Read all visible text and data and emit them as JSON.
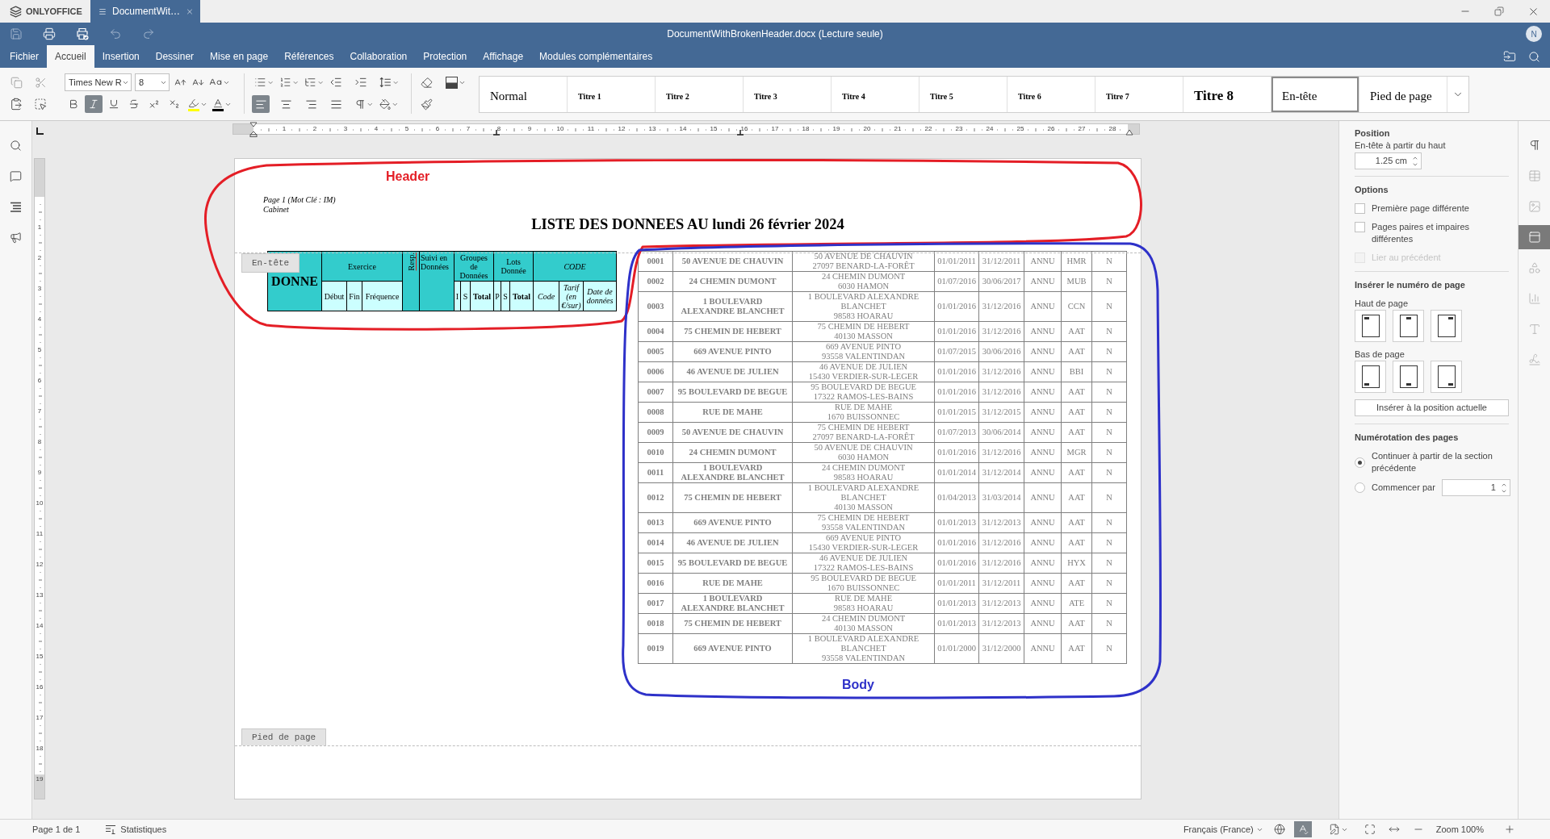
{
  "window": {
    "brand": "ONLYOFFICE",
    "tabs": [
      {
        "label": "DocumentWit…",
        "selected": true
      }
    ]
  },
  "title_bar": {
    "title": "DocumentWithBrokenHeader.docx (Lecture seule)",
    "avatar": "N",
    "quick_access": [
      {
        "kind": "save",
        "disabled": true
      },
      {
        "kind": "print",
        "disabled": false
      },
      {
        "kind": "quick_print",
        "disabled": false
      },
      {
        "kind": "undo",
        "disabled": true
      },
      {
        "kind": "redo",
        "disabled": true
      }
    ]
  },
  "menu": [
    {
      "label": "Fichier",
      "selected": false
    },
    {
      "label": "Accueil",
      "selected": true
    },
    {
      "label": "Insertion",
      "selected": false
    },
    {
      "label": "Dessiner",
      "selected": false
    },
    {
      "label": "Mise en page",
      "selected": false
    },
    {
      "label": "Références",
      "selected": false
    },
    {
      "label": "Collaboration",
      "selected": false
    },
    {
      "label": "Protection",
      "selected": false
    },
    {
      "label": "Affichage",
      "selected": false
    },
    {
      "label": "Modules complémentaires",
      "selected": false
    }
  ],
  "toolbar": {
    "font_name": "Times New R",
    "font_size": "8",
    "character": [
      {
        "kind": "bold",
        "selected": false
      },
      {
        "kind": "italic",
        "selected": true
      },
      {
        "kind": "underline",
        "selected": false
      },
      {
        "kind": "strikethrough",
        "selected": false
      },
      {
        "kind": "superscript",
        "selected": false
      },
      {
        "kind": "subscript",
        "selected": false
      }
    ],
    "alignment": [
      {
        "kind": "left",
        "selected": true
      },
      {
        "kind": "center",
        "selected": false
      },
      {
        "kind": "right",
        "selected": false
      },
      {
        "kind": "justify",
        "selected": false
      }
    ],
    "styles": [
      {
        "label": "Normal",
        "kind": "body",
        "selected": false
      },
      {
        "label": "Titre 1",
        "kind": "minor",
        "selected": false
      },
      {
        "label": "Titre 2",
        "kind": "minor",
        "selected": false
      },
      {
        "label": "Titre 3",
        "kind": "minor",
        "selected": false
      },
      {
        "label": "Titre 4",
        "kind": "minor",
        "selected": false
      },
      {
        "label": "Titre 5",
        "kind": "minor",
        "selected": false
      },
      {
        "label": "Titre 6",
        "kind": "minor",
        "selected": false
      },
      {
        "label": "Titre 7",
        "kind": "minor",
        "selected": false
      },
      {
        "label": "Titre 8",
        "kind": "major",
        "selected": false
      },
      {
        "label": "En-tête",
        "kind": "body",
        "selected": true
      },
      {
        "label": "Pied de page",
        "kind": "body",
        "selected": false
      }
    ]
  },
  "ruler": {
    "horizontal": [
      "1",
      "2",
      "3",
      "4",
      "5",
      "6",
      "7",
      "8",
      "9",
      "10",
      "11",
      "12",
      "13",
      "14",
      "15",
      "16",
      "17",
      "18",
      "19",
      "20",
      "21",
      "22",
      "23",
      "24",
      "25",
      "26",
      "27",
      "28"
    ],
    "vertical": [
      "1",
      "2",
      "3",
      "4",
      "5",
      "6",
      "7",
      "8",
      "9",
      "10",
      "11",
      "12",
      "13",
      "14",
      "15",
      "16",
      "17",
      "18",
      "19"
    ]
  },
  "document": {
    "header_label": "En-tête",
    "footer_label": "Pied de page",
    "header_lines": [
      "Page 1 (Mot Clé : IM)",
      "Cabinet"
    ],
    "title": "LISTE DES DONNEES AU lundi 26 février 2024",
    "header_table": {
      "groups": [
        {
          "label": "DONNE",
          "kind": "main",
          "italic": false
        },
        {
          "label": "Exercice",
          "kind": "group",
          "italic": false,
          "subs": [
            {
              "label": "Début",
              "bold": false
            },
            {
              "label": "Fin",
              "bold": false
            },
            {
              "label": "Fréquence",
              "bold": false
            }
          ]
        },
        {
          "label": "Resp.",
          "kind": "vertical",
          "italic": false,
          "misspelled": true
        },
        {
          "label": "Suivi en Données",
          "kind": "tall",
          "italic": false
        },
        {
          "label": "Groupes de Données",
          "kind": "group",
          "italic": false,
          "subs": [
            {
              "label": "I",
              "bold": false
            },
            {
              "label": "S",
              "bold": false
            },
            {
              "label": "Total",
              "bold": true
            }
          ]
        },
        {
          "label": "Lots Donnée",
          "kind": "group",
          "italic": false,
          "subs": [
            {
              "label": "P",
              "bold": false
            },
            {
              "label": "S",
              "bold": false
            },
            {
              "label": "Total",
              "bold": true
            }
          ]
        },
        {
          "label": "CODE",
          "kind": "group",
          "italic": true,
          "subs": [
            {
              "label": "Code",
              "bold": false
            },
            {
              "label": "Tarif (en €/sur)",
              "bold": false
            },
            {
              "label": "Date de données",
              "bold": false
            }
          ]
        }
      ]
    },
    "body_table": {
      "rows": [
        {
          "number": "0001",
          "name": "50 AVENUE DE CHAUVIN",
          "address": [
            "50 AVENUE DE CHAUVIN",
            "27097 BENARD-LA-FORÊT"
          ],
          "start": "01/01/2011",
          "end": "31/12/2011",
          "period": "ANNU",
          "code": "HMR",
          "flag": "N"
        },
        {
          "number": "0002",
          "name": "24 CHEMIN DUMONT",
          "address": [
            "24 CHEMIN DUMONT",
            "6030 HAMON"
          ],
          "start": "01/07/2016",
          "end": "30/06/2017",
          "period": "ANNU",
          "code": "MUB",
          "flag": "N"
        },
        {
          "number": "0003",
          "name": "1 BOULEVARD ALEXANDRE BLANCHET",
          "address": [
            "1 BOULEVARD ALEXANDRE BLANCHET",
            "98583 HOARAU"
          ],
          "start": "01/01/2016",
          "end": "31/12/2016",
          "period": "ANNU",
          "code": "CCN",
          "flag": "N"
        },
        {
          "number": "0004",
          "name": "75 CHEMIN DE HEBERT",
          "address": [
            "75 CHEMIN DE HEBERT",
            "40130 MASSON"
          ],
          "start": "01/01/2016",
          "end": "31/12/2016",
          "period": "ANNU",
          "code": "AAT",
          "flag": "N"
        },
        {
          "number": "0005",
          "name": "669 AVENUE PINTO",
          "address": [
            "669 AVENUE PINTO",
            "93558 VALENTINDAN"
          ],
          "start": "01/07/2015",
          "end": "30/06/2016",
          "period": "ANNU",
          "code": "AAT",
          "flag": "N"
        },
        {
          "number": "0006",
          "name": "46 AVENUE DE JULIEN",
          "address": [
            "46 AVENUE DE JULIEN",
            "15430 VERDIER-SUR-LEGER"
          ],
          "start": "01/01/2016",
          "end": "31/12/2016",
          "period": "ANNU",
          "code": "BBI",
          "flag": "N"
        },
        {
          "number": "0007",
          "name": "95 BOULEVARD DE BEGUE",
          "address": [
            "95 BOULEVARD DE BEGUE",
            "17322 RAMOS-LES-BAINS"
          ],
          "start": "01/01/2016",
          "end": "31/12/2016",
          "period": "ANNU",
          "code": "AAT",
          "flag": "N"
        },
        {
          "number": "0008",
          "name": "RUE DE MAHE",
          "address": [
            "RUE DE MAHE",
            "1670 BUISSONNEC"
          ],
          "start": "01/01/2015",
          "end": "31/12/2015",
          "period": "ANNU",
          "code": "AAT",
          "flag": "N"
        },
        {
          "number": "0009",
          "name": "50 AVENUE DE CHAUVIN",
          "address": [
            "75 CHEMIN DE HEBERT",
            "27097 BENARD-LA-FORÊT"
          ],
          "start": "01/07/2013",
          "end": "30/06/2014",
          "period": "ANNU",
          "code": "AAT",
          "flag": "N"
        },
        {
          "number": "0010",
          "name": "24 CHEMIN DUMONT",
          "address": [
            "50 AVENUE DE CHAUVIN",
            "6030 HAMON"
          ],
          "start": "01/01/2016",
          "end": "31/12/2016",
          "period": "ANNU",
          "code": "MGR",
          "flag": "N"
        },
        {
          "number": "0011",
          "name": "1 BOULEVARD ALEXANDRE BLANCHET",
          "address": [
            "24 CHEMIN DUMONT",
            "98583 HOARAU"
          ],
          "start": "01/01/2014",
          "end": "31/12/2014",
          "period": "ANNU",
          "code": "AAT",
          "flag": "N"
        },
        {
          "number": "0012",
          "name": "75 CHEMIN DE HEBERT",
          "address": [
            "1 BOULEVARD ALEXANDRE BLANCHET",
            "40130 MASSON"
          ],
          "start": "01/04/2013",
          "end": "31/03/2014",
          "period": "ANNU",
          "code": "AAT",
          "flag": "N"
        },
        {
          "number": "0013",
          "name": "669 AVENUE PINTO",
          "address": [
            "75 CHEMIN DE HEBERT",
            "93558 VALENTINDAN"
          ],
          "start": "01/01/2013",
          "end": "31/12/2013",
          "period": "ANNU",
          "code": "AAT",
          "flag": "N"
        },
        {
          "number": "0014",
          "name": "46 AVENUE DE JULIEN",
          "address": [
            "669 AVENUE PINTO",
            "15430 VERDIER-SUR-LEGER"
          ],
          "start": "01/01/2016",
          "end": "31/12/2016",
          "period": "ANNU",
          "code": "AAT",
          "flag": "N"
        },
        {
          "number": "0015",
          "name": "95 BOULEVARD DE BEGUE",
          "address": [
            "46 AVENUE DE JULIEN",
            "17322 RAMOS-LES-BAINS"
          ],
          "start": "01/01/2016",
          "end": "31/12/2016",
          "period": "ANNU",
          "code": "HYX",
          "flag": "N"
        },
        {
          "number": "0016",
          "name": "RUE DE MAHE",
          "address": [
            "95 BOULEVARD DE BEGUE",
            "1670 BUISSONNEC"
          ],
          "start": "01/01/2011",
          "end": "31/12/2011",
          "period": "ANNU",
          "code": "AAT",
          "flag": "N"
        },
        {
          "number": "0017",
          "name": "1 BOULEVARD ALEXANDRE BLANCHET",
          "address": [
            "RUE DE MAHE",
            "98583 HOARAU"
          ],
          "start": "01/01/2013",
          "end": "31/12/2013",
          "period": "ANNU",
          "code": "ATE",
          "flag": "N"
        },
        {
          "number": "0018",
          "name": "75 CHEMIN DE HEBERT",
          "address": [
            "24 CHEMIN DUMONT",
            "40130 MASSON"
          ],
          "start": "01/01/2013",
          "end": "31/12/2013",
          "period": "ANNU",
          "code": "AAT",
          "flag": "N"
        },
        {
          "number": "0019",
          "name": "669 AVENUE PINTO",
          "address": [
            "1 BOULEVARD ALEXANDRE BLANCHET",
            "93558 VALENTINDAN"
          ],
          "start": "01/01/2000",
          "end": "31/12/2000",
          "period": "ANNU",
          "code": "AAT",
          "flag": "N"
        }
      ]
    }
  },
  "annotations": [
    {
      "kind": "header",
      "label": "Header",
      "color": "#e41e26"
    },
    {
      "kind": "body",
      "label": "Body",
      "color": "#2e31c9"
    }
  ],
  "right_panel": {
    "position": {
      "title": "Position",
      "label": "En-tête à partir du haut",
      "value": "1.25 cm"
    },
    "options": {
      "title": "Options",
      "items": [
        {
          "label": "Première page différente",
          "checked": false,
          "disabled": false
        },
        {
          "label": "Pages paires et impaires différentes",
          "checked": false,
          "disabled": false
        },
        {
          "label": "Lier au précédent",
          "checked": false,
          "disabled": true
        }
      ]
    },
    "page_number": {
      "title": "Insérer le numéro de page",
      "top_label": "Haut de page",
      "bottom_label": "Bas de page",
      "button": "Insérer à la position actuelle"
    },
    "numbering": {
      "title": "Numérotation des pages",
      "options": [
        {
          "label": "Continuer à partir de la section précédente",
          "selected": true
        },
        {
          "label": "Commencer par",
          "selected": false
        }
      ],
      "start_value": "1"
    }
  },
  "right_rail": [
    {
      "kind": "paragraph",
      "selected": false,
      "disabled": false
    },
    {
      "kind": "table",
      "selected": false,
      "disabled": true
    },
    {
      "kind": "image",
      "selected": false,
      "disabled": true
    },
    {
      "kind": "header_footer",
      "selected": true,
      "disabled": false
    },
    {
      "kind": "shape",
      "selected": false,
      "disabled": true
    },
    {
      "kind": "chart",
      "selected": false,
      "disabled": true
    },
    {
      "kind": "text_art",
      "selected": false,
      "disabled": true
    },
    {
      "kind": "signature",
      "selected": false,
      "disabled": true
    }
  ],
  "status_bar": {
    "page": "Page 1 de 1",
    "stats": "Statistiques",
    "language": "Français (France)",
    "spell_check": {
      "selected": true
    },
    "zoom": "Zoom 100%"
  }
}
